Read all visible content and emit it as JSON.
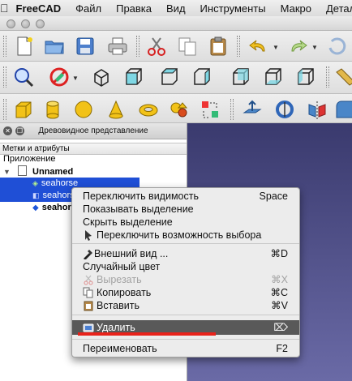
{
  "menubar": {
    "app_name": "FreeCAD",
    "items": [
      "Файл",
      "Правка",
      "Вид",
      "Инструменты",
      "Макро",
      "Детали"
    ]
  },
  "tree_panel": {
    "title": "Древовидное представление",
    "column_header": "Метки и атрибуты",
    "root_label": "Приложение",
    "document_label": "Unnamed",
    "items": [
      {
        "label": "seahorse"
      },
      {
        "label": "seahorse"
      },
      {
        "label": "seahorse"
      }
    ]
  },
  "context_menu": {
    "toggle_visibility": {
      "label": "Переключить видимость",
      "shortcut": "Space"
    },
    "show_selection": {
      "label": "Показывать выделение"
    },
    "hide_selection": {
      "label": "Скрыть выделение"
    },
    "toggle_selectable": {
      "label": "Переключить возможность выбора"
    },
    "appearance": {
      "label": "Внешний вид ...",
      "shortcut": "⌘D"
    },
    "random_color": {
      "label": "Случайный цвет"
    },
    "cut": {
      "label": "Вырезать",
      "shortcut": "⌘X"
    },
    "copy": {
      "label": "Копировать",
      "shortcut": "⌘C"
    },
    "paste": {
      "label": "Вставить",
      "shortcut": "⌘V"
    },
    "delete": {
      "label": "Удалить",
      "shortcut": "⌦"
    },
    "rename": {
      "label": "Переименовать",
      "shortcut": "F2"
    }
  },
  "colors": {
    "selection": "#1f4fd6",
    "menu_highlight": "#595959",
    "annotation_red": "#e8221a",
    "view_background_top": "#3a3a6e"
  }
}
